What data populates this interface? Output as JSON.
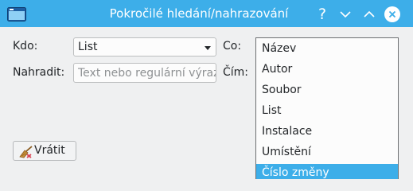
{
  "window": {
    "title": "Pokročilé hledání/nahrazování",
    "help_symbol": "?"
  },
  "form": {
    "who_label": "Kdo:",
    "who_value": "List",
    "what_label": "Co:",
    "replace_label": "Nahradit:",
    "replace_placeholder": "Text nebo regulární výraz",
    "with_label": "Čím:"
  },
  "dropdown": {
    "items": [
      "Název",
      "Autor",
      "Soubor",
      "List",
      "Instalace",
      "Umístění",
      "Číslo změny"
    ],
    "selected": "Číslo změny"
  },
  "buttons": {
    "revert_label": "Vrátit"
  },
  "colors": {
    "titlebar": "#3daee9",
    "selection": "#3daee9",
    "window_bg": "#eff0f1"
  }
}
